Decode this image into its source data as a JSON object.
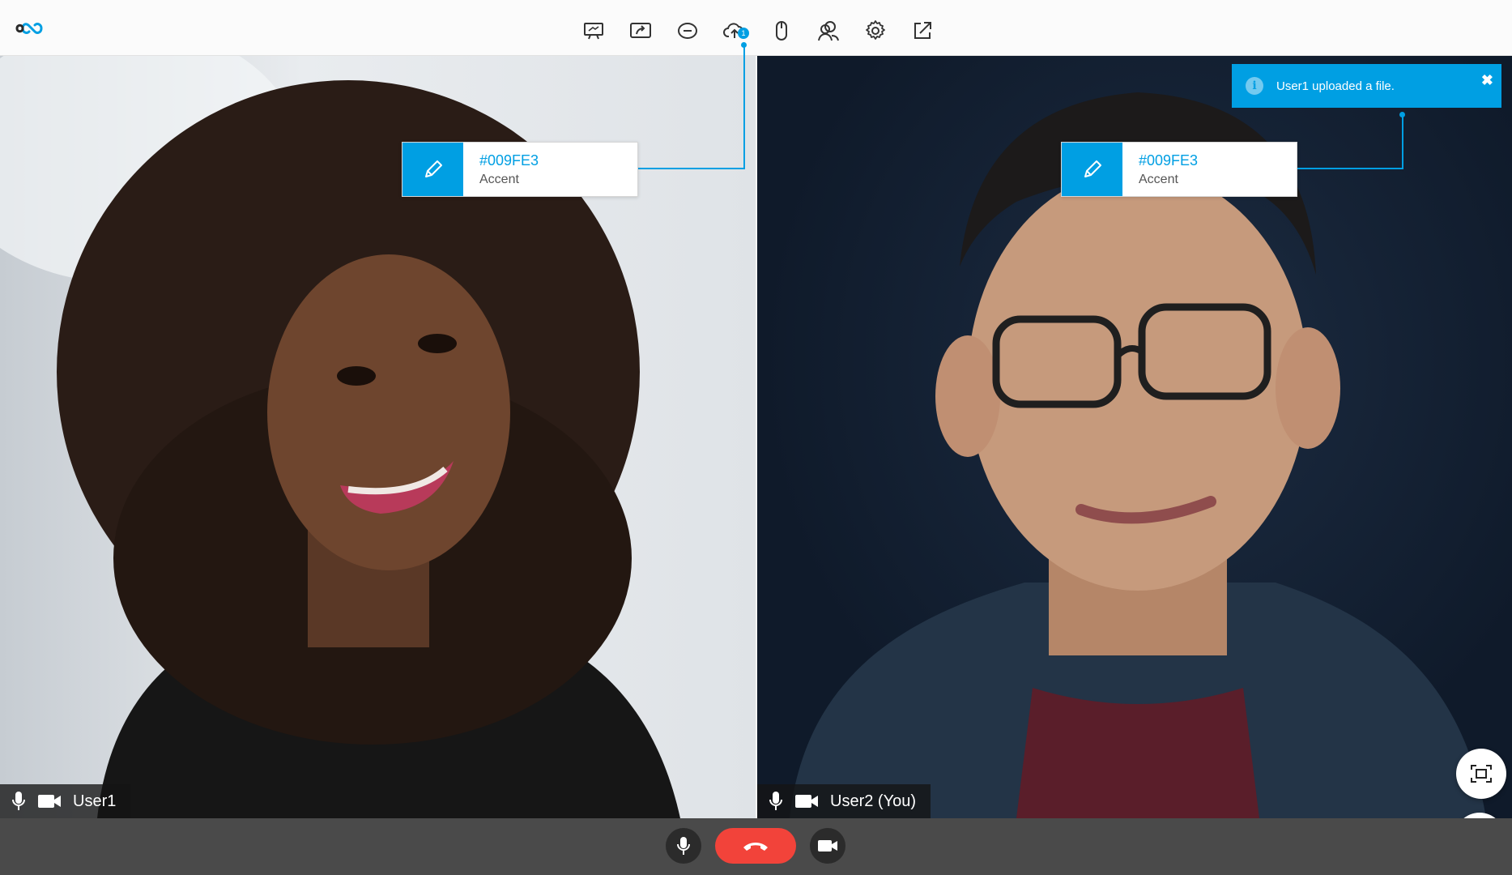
{
  "toolbar": {
    "icons": [
      "presentation-icon",
      "share-screen-icon",
      "chat-icon",
      "cloud-upload-icon",
      "mouse-icon",
      "participants-icon",
      "settings-icon",
      "pop-out-icon"
    ],
    "upload_badge": "1"
  },
  "accent_color": "#009FE3",
  "callouts": [
    {
      "hex": "#009FE3",
      "name": "Accent"
    },
    {
      "hex": "#009FE3",
      "name": "Accent"
    }
  ],
  "notification": {
    "message": "User1 uploaded a file."
  },
  "participants": [
    {
      "name": "User1"
    },
    {
      "name": "User2 (You)"
    }
  ],
  "controls": {
    "mic": "microphone-icon",
    "hangup": "hang-up-icon",
    "camera": "camera-icon",
    "fullscreen": "fullscreen-icon",
    "share": "share-upload-icon"
  }
}
